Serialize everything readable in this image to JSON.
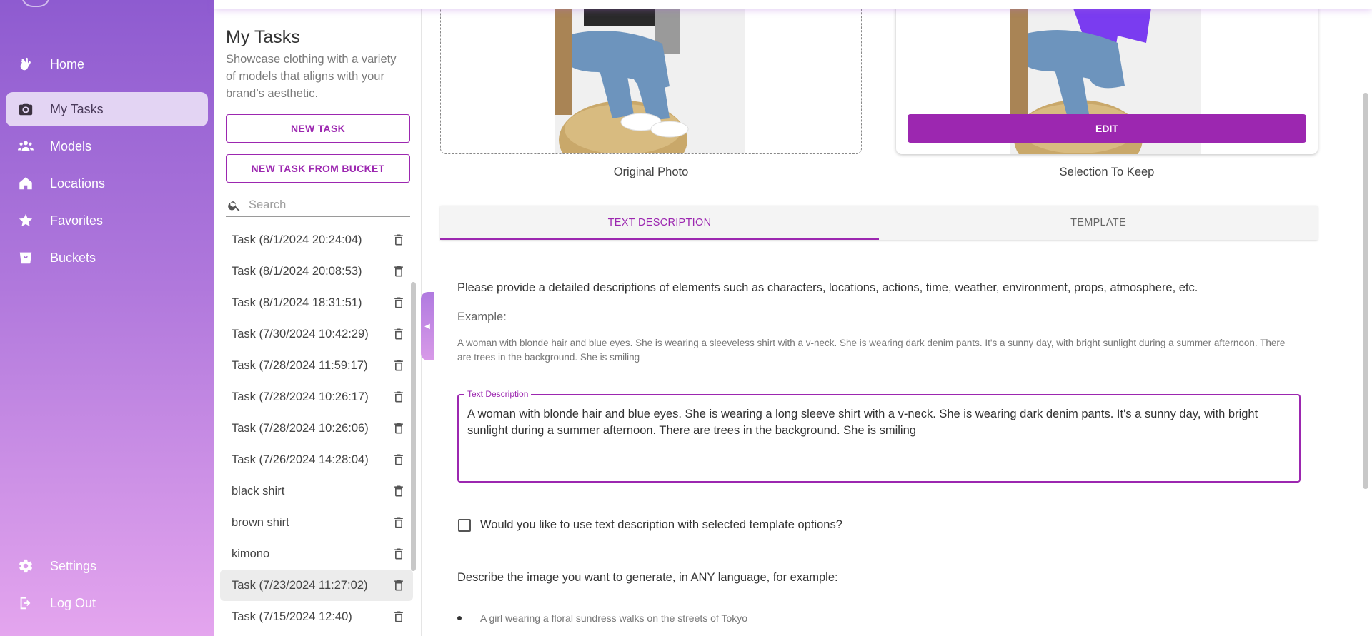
{
  "nav": {
    "items": [
      {
        "label": "Home",
        "icon": "waving-hand-icon"
      },
      {
        "label": "My Tasks",
        "icon": "camera-icon"
      },
      {
        "label": "Models",
        "icon": "people-icon"
      },
      {
        "label": "Locations",
        "icon": "home-icon"
      },
      {
        "label": "Favorites",
        "icon": "star-icon"
      },
      {
        "label": "Buckets",
        "icon": "bucket-icon"
      }
    ],
    "bottom": [
      {
        "label": "Settings",
        "icon": "gear-icon"
      },
      {
        "label": "Log Out",
        "icon": "logout-icon"
      }
    ],
    "active": "My Tasks"
  },
  "tasks_panel": {
    "title": "My Tasks",
    "description": "Showcase clothing with a variety of models that aligns with your brand’s aesthetic.",
    "new_task_label": "NEW TASK",
    "new_task_bucket_label": "NEW TASK FROM BUCKET",
    "search_placeholder": "Search",
    "items": [
      "Task (8/1/2024 20:24:04)",
      "Task (8/1/2024 20:08:53)",
      "Task (8/1/2024 18:31:51)",
      "Task (7/30/2024 10:42:29)",
      "Task (7/28/2024 11:59:17)",
      "Task (7/28/2024 10:26:17)",
      "Task (7/28/2024 10:26:06)",
      "Task (7/26/2024 14:28:04)",
      "black shirt",
      "brown shirt",
      "kimono",
      "Task (7/23/2024 11:27:02)",
      "Task (7/15/2024 12:40)"
    ],
    "selected_index": 11
  },
  "photos": {
    "original_caption": "Original Photo",
    "keep_caption": "Selection To Keep",
    "edit_label": "EDIT"
  },
  "tabs": [
    "TEXT DESCRIPTION",
    "TEMPLATE"
  ],
  "content": {
    "instruction": "Please provide a detailed descriptions of elements such as characters, locations, actions, time, weather, environment, props, atmosphere, etc.",
    "example_label": "Example:",
    "example_text": "A woman with blonde hair and blue eyes. She is wearing a sleeveless shirt with a v-neck. She is wearing dark denim pants. It's a sunny day, with bright sunlight during a summer afternoon. There are trees in the background. She is smiling",
    "field_label": "Text Description",
    "field_value": "A woman with blonde hair and blue eyes. She is wearing a long sleeve shirt with a v-neck. She is wearing dark denim pants. It's a sunny day, with bright sunlight during a summer afternoon. There are trees in the background. She is smiling",
    "checkbox_label": "Would you like to use text description with selected template options?",
    "describe_label": "Describe the image you want to generate, in ANY language, for example:",
    "bullet_example": "A girl wearing a floral sundress walks on the streets of Tokyo"
  },
  "colors": {
    "accent": "#9c27b0",
    "nav_top": "#8e5bd0",
    "nav_bottom": "#e4a5ee"
  }
}
